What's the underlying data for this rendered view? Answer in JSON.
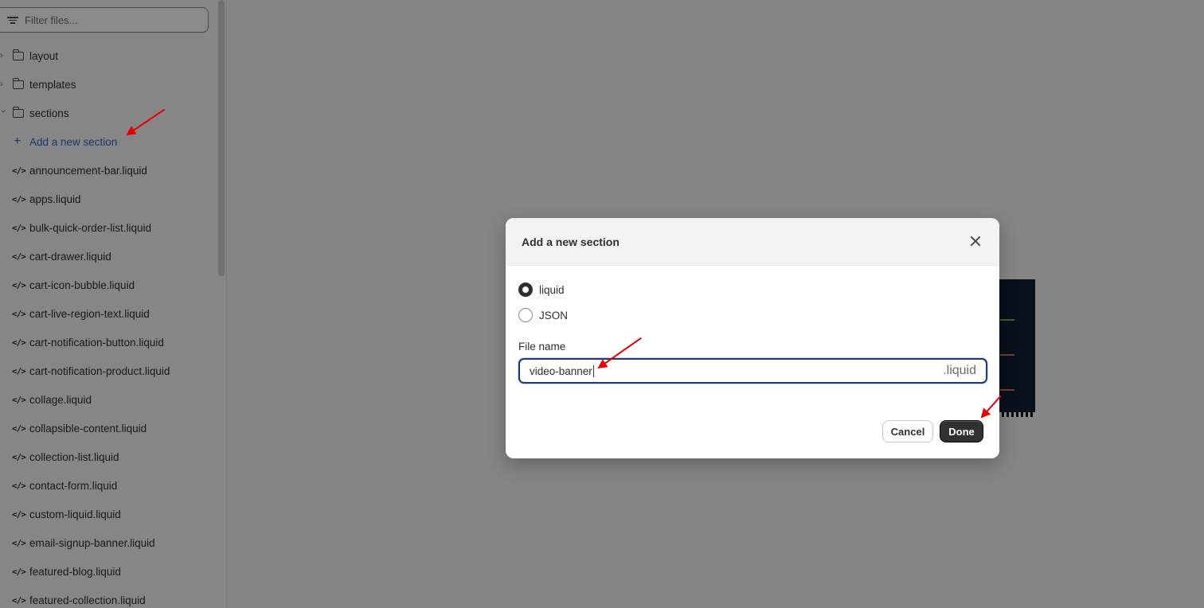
{
  "sidebar": {
    "filter_placeholder": "Filter files...",
    "folders": [
      {
        "label": "layout",
        "expanded": false
      },
      {
        "label": "templates",
        "expanded": false
      },
      {
        "label": "sections",
        "expanded": true
      }
    ],
    "add_section_label": "Add a new section",
    "files": [
      "announcement-bar.liquid",
      "apps.liquid",
      "bulk-quick-order-list.liquid",
      "cart-drawer.liquid",
      "cart-icon-bubble.liquid",
      "cart-live-region-text.liquid",
      "cart-notification-button.liquid",
      "cart-notification-product.liquid",
      "collage.liquid",
      "collapsible-content.liquid",
      "collection-list.liquid",
      "contact-form.liquid",
      "custom-liquid.liquid",
      "email-signup-banner.liquid",
      "featured-blog.liquid",
      "featured-collection.liquid"
    ]
  },
  "modal": {
    "title": "Add a new section",
    "options": [
      {
        "label": "liquid",
        "selected": true
      },
      {
        "label": "JSON",
        "selected": false
      }
    ],
    "file_name_label": "File name",
    "file_name_value": "video-banner",
    "file_suffix": ".liquid",
    "cancel_label": "Cancel",
    "done_label": "Done"
  },
  "colors": {
    "accent_link": "#2c6ecb",
    "primary_button": "#303030",
    "annotation_arrow": "#e60000",
    "overlay": "rgba(0,0,0,0.46)"
  }
}
